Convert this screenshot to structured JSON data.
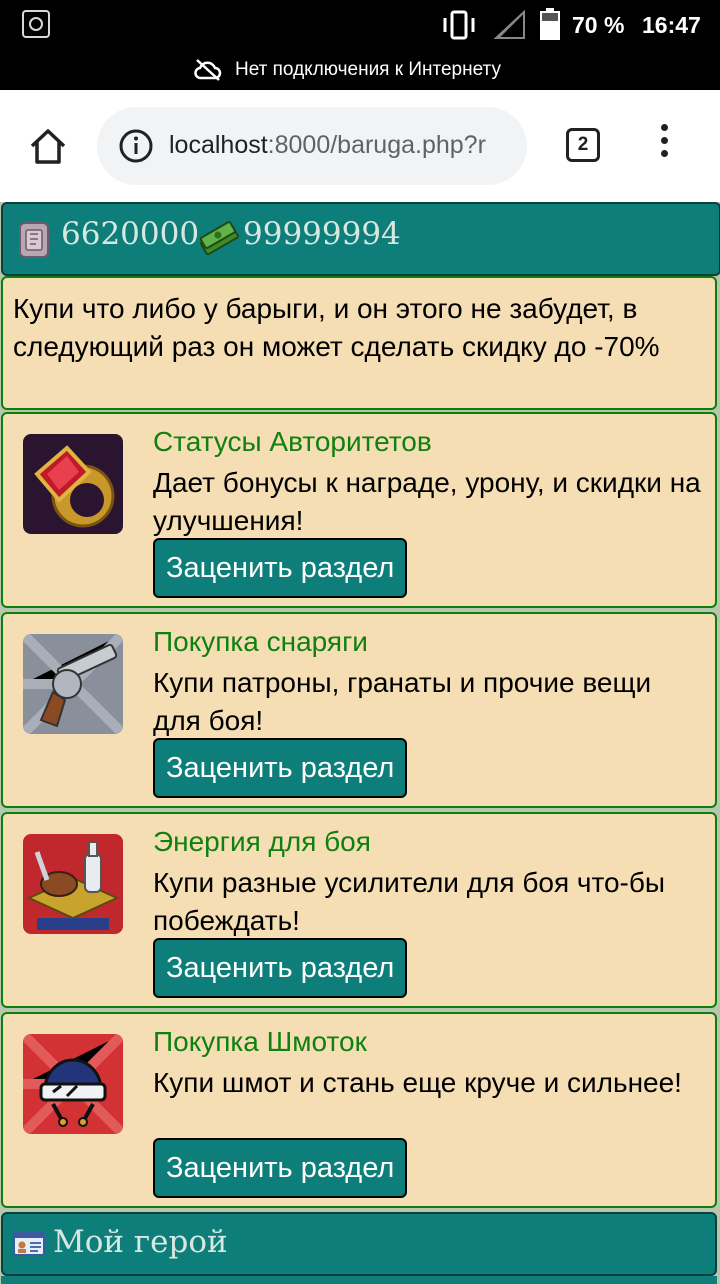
{
  "statusbar": {
    "battery_pct": "70 %",
    "time": "16:47"
  },
  "offline": {
    "text": "Нет подключения к Интернету"
  },
  "browser": {
    "url_host": "localhost",
    "url_path": ":8000/baruga.php?r",
    "tab_count": "2"
  },
  "currency": {
    "coins": "6620000",
    "cash": "99999994"
  },
  "info": {
    "text": "Купи что либо у барыги, и он этого не забудет, в следующий раз он может сделать скидку до -70%"
  },
  "cards": [
    {
      "title": "Статусы Авторитетов",
      "desc": "Дает бонусы к награде, урону, и скидки на улучшения!",
      "button": "Заценить раздел",
      "icon": "gold-ring-icon"
    },
    {
      "title": "Покупка снаряги",
      "desc": "Купи патроны, гранаты и прочие вещи для боя!",
      "button": "Заценить раздел",
      "icon": "revolver-icon"
    },
    {
      "title": "Энергия для боя",
      "desc": "Купи разные усилители для боя что-бы побеждать!",
      "button": "Заценить раздел",
      "icon": "food-tray-icon"
    },
    {
      "title": "Покупка Шмоток",
      "desc": "Купи шмот и стань еще круче и сильнее!",
      "button": "Заценить раздел",
      "icon": "helmet-icon"
    }
  ],
  "footer": {
    "hero_label": "Мой герой"
  },
  "colors": {
    "teal": "#0e7e7a",
    "beige": "#f5deb3",
    "green_title": "#108010",
    "border_green": "#0c7f0c"
  }
}
